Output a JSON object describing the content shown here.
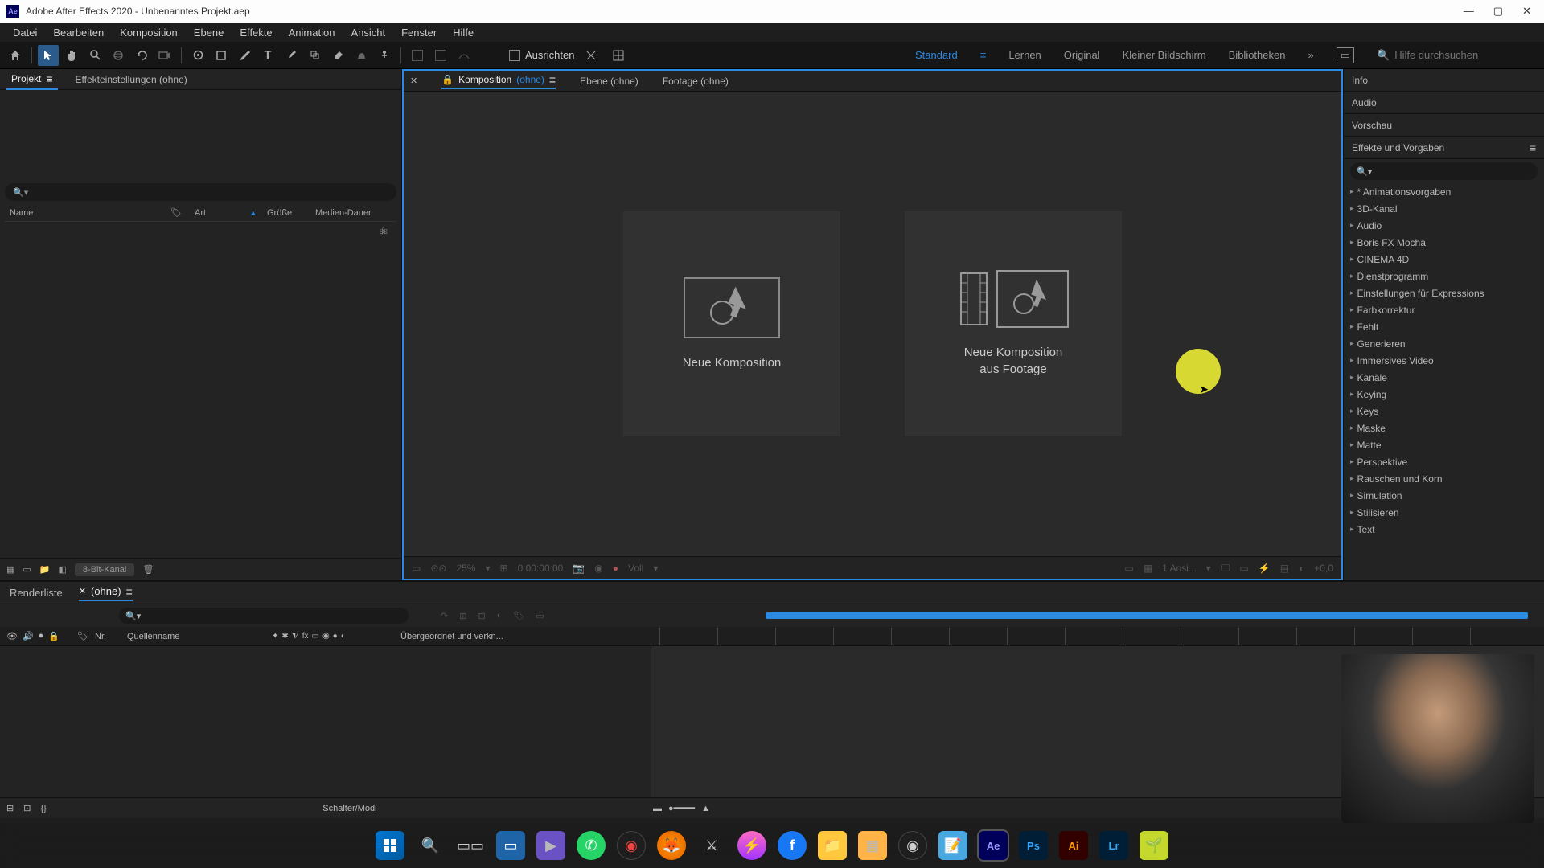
{
  "titlebar": {
    "app": "Adobe After Effects 2020",
    "project": "Unbenanntes Projekt.aep"
  },
  "menubar": [
    "Datei",
    "Bearbeiten",
    "Komposition",
    "Ebene",
    "Effekte",
    "Animation",
    "Ansicht",
    "Fenster",
    "Hilfe"
  ],
  "toolbar": {
    "snap_label": "Ausrichten"
  },
  "workspaces": {
    "items": [
      "Standard",
      "Lernen",
      "Original",
      "Kleiner Bildschirm",
      "Bibliotheken"
    ],
    "active": "Standard",
    "search_placeholder": "Hilfe durchsuchen"
  },
  "left_panel": {
    "tabs": [
      "Projekt",
      "Effekteinstellungen (ohne)"
    ],
    "columns": {
      "name": "Name",
      "art": "Art",
      "size": "Größe",
      "duration": "Medien-Dauer"
    },
    "footer_chip": "8-Bit-Kanal"
  },
  "comp_panel": {
    "tab_comp": "Komposition",
    "tab_comp_none": "(ohne)",
    "tab_layer": "Ebene (ohne)",
    "tab_footage": "Footage (ohne)",
    "card_new_comp": "Neue Komposition",
    "card_from_footage_l1": "Neue Komposition",
    "card_from_footage_l2": "aus Footage",
    "zoom": "25%",
    "timecode": "0:00:00:00",
    "res": "Voll",
    "views": "1 Ansi...",
    "exp": "+0,0"
  },
  "right_panel": {
    "sections": [
      "Info",
      "Audio",
      "Vorschau",
      "Effekte und Vorgaben"
    ],
    "effects": [
      "* Animationsvorgaben",
      "3D-Kanal",
      "Audio",
      "Boris FX Mocha",
      "CINEMA 4D",
      "Dienstprogramm",
      "Einstellungen für Expressions",
      "Farbkorrektur",
      "Fehlt",
      "Generieren",
      "Immersives Video",
      "Kanäle",
      "Keying",
      "Keys",
      "Maske",
      "Matte",
      "Perspektive",
      "Rauschen und Korn",
      "Simulation",
      "Stilisieren",
      "Text"
    ]
  },
  "timeline": {
    "tab_render": "Renderliste",
    "tab_none": "(ohne)",
    "col_nr": "Nr.",
    "col_source": "Quellenname",
    "col_parent": "Übergeordnet und verkn...",
    "footer_toggle": "Schalter/Modi"
  },
  "taskbar_apps": [
    "Ae",
    "Ps",
    "Ai",
    "Lr"
  ]
}
